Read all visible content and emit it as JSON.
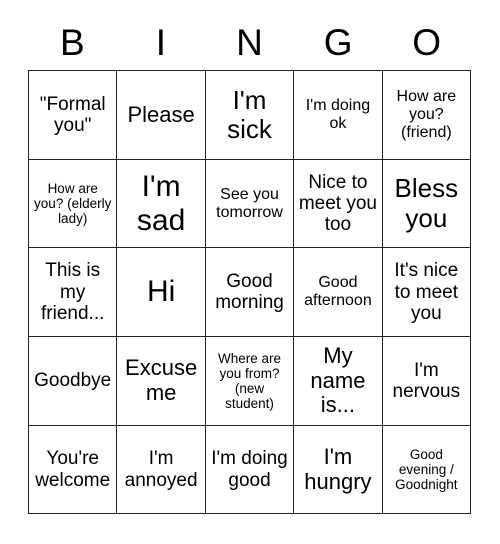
{
  "header": {
    "letters": [
      "B",
      "I",
      "N",
      "G",
      "O"
    ]
  },
  "grid": {
    "rows": [
      [
        {
          "text": "\"Formal you\"",
          "size": "fs-md"
        },
        {
          "text": "Please",
          "size": "fs-lg"
        },
        {
          "text": "I'm sick",
          "size": "fs-xl"
        },
        {
          "text": "I'm doing ok",
          "size": "fs-sm"
        },
        {
          "text": "How are you? (friend)",
          "size": "fs-sm"
        }
      ],
      [
        {
          "text": "How are you? (elderly lady)",
          "size": "fs-xs"
        },
        {
          "text": "I'm sad",
          "size": "fs-xxl"
        },
        {
          "text": "See you tomorrow",
          "size": "fs-sm"
        },
        {
          "text": "Nice to meet you too",
          "size": "fs-md"
        },
        {
          "text": "Bless you",
          "size": "fs-xl"
        }
      ],
      [
        {
          "text": "This is my friend...",
          "size": "fs-md"
        },
        {
          "text": "Hi",
          "size": "fs-xxl"
        },
        {
          "text": "Good morning",
          "size": "fs-md"
        },
        {
          "text": "Good afternoon",
          "size": "fs-sm"
        },
        {
          "text": "It's nice to meet you",
          "size": "fs-md"
        }
      ],
      [
        {
          "text": "Goodbye",
          "size": "fs-md"
        },
        {
          "text": "Excuse me",
          "size": "fs-lg"
        },
        {
          "text": "Where are you from? (new student)",
          "size": "fs-xs"
        },
        {
          "text": "My name is...",
          "size": "fs-lg"
        },
        {
          "text": "I'm nervous",
          "size": "fs-md"
        }
      ],
      [
        {
          "text": "You're welcome",
          "size": "fs-md"
        },
        {
          "text": "I'm annoyed",
          "size": "fs-md"
        },
        {
          "text": "I'm doing good",
          "size": "fs-md"
        },
        {
          "text": "I'm hungry",
          "size": "fs-lg"
        },
        {
          "text": "Good evening / Goodnight",
          "size": "fs-xs"
        }
      ]
    ]
  },
  "colors": {
    "border": "#222222",
    "text": "#000000",
    "background": "#ffffff"
  }
}
